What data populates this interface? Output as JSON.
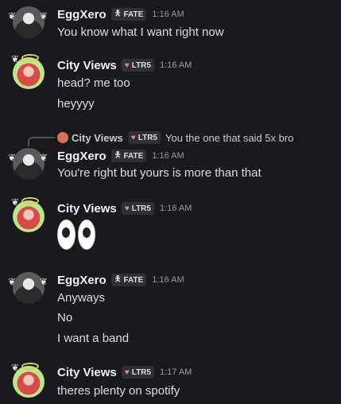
{
  "messages": [
    {
      "user": "EggXero",
      "badge": {
        "icon": "figure-icon",
        "label": "FATE"
      },
      "time": "1:16 AM",
      "lines": [
        "You know what I want right now"
      ]
    },
    {
      "user": "City Views",
      "badge": {
        "icon": "heart-icon",
        "label": "LTR5"
      },
      "time": "1:16 AM",
      "lines": [
        "head? me too",
        "heyyyy"
      ]
    },
    {
      "reply": {
        "user": "City Views",
        "badge": "LTR5",
        "text": "You the one that said 5x bro"
      },
      "user": "EggXero",
      "badge": {
        "icon": "figure-icon",
        "label": "FATE"
      },
      "time": "1:16 AM",
      "lines": [
        "You're right but yours is more than that"
      ]
    },
    {
      "user": "City Views",
      "badge": {
        "icon": "heart-icon",
        "label": "LTR5"
      },
      "time": "1:16 AM",
      "emoji": "eyes-emoji"
    },
    {
      "user": "EggXero",
      "badge": {
        "icon": "figure-icon",
        "label": "FATE"
      },
      "time": "1:16 AM",
      "lines": [
        "Anyways",
        "No",
        "I want a band"
      ]
    },
    {
      "user": "City Views",
      "badge": {
        "icon": "heart-icon",
        "label": "LTR5"
      },
      "time": "1:17 AM",
      "lines": [
        "theres plenty on spotify"
      ]
    }
  ],
  "colors": {
    "background": "#1a1a1e",
    "username": "#f2f3f5",
    "text": "#dbdee1",
    "timestamp": "#949ba4",
    "heart": "#e879c9"
  }
}
